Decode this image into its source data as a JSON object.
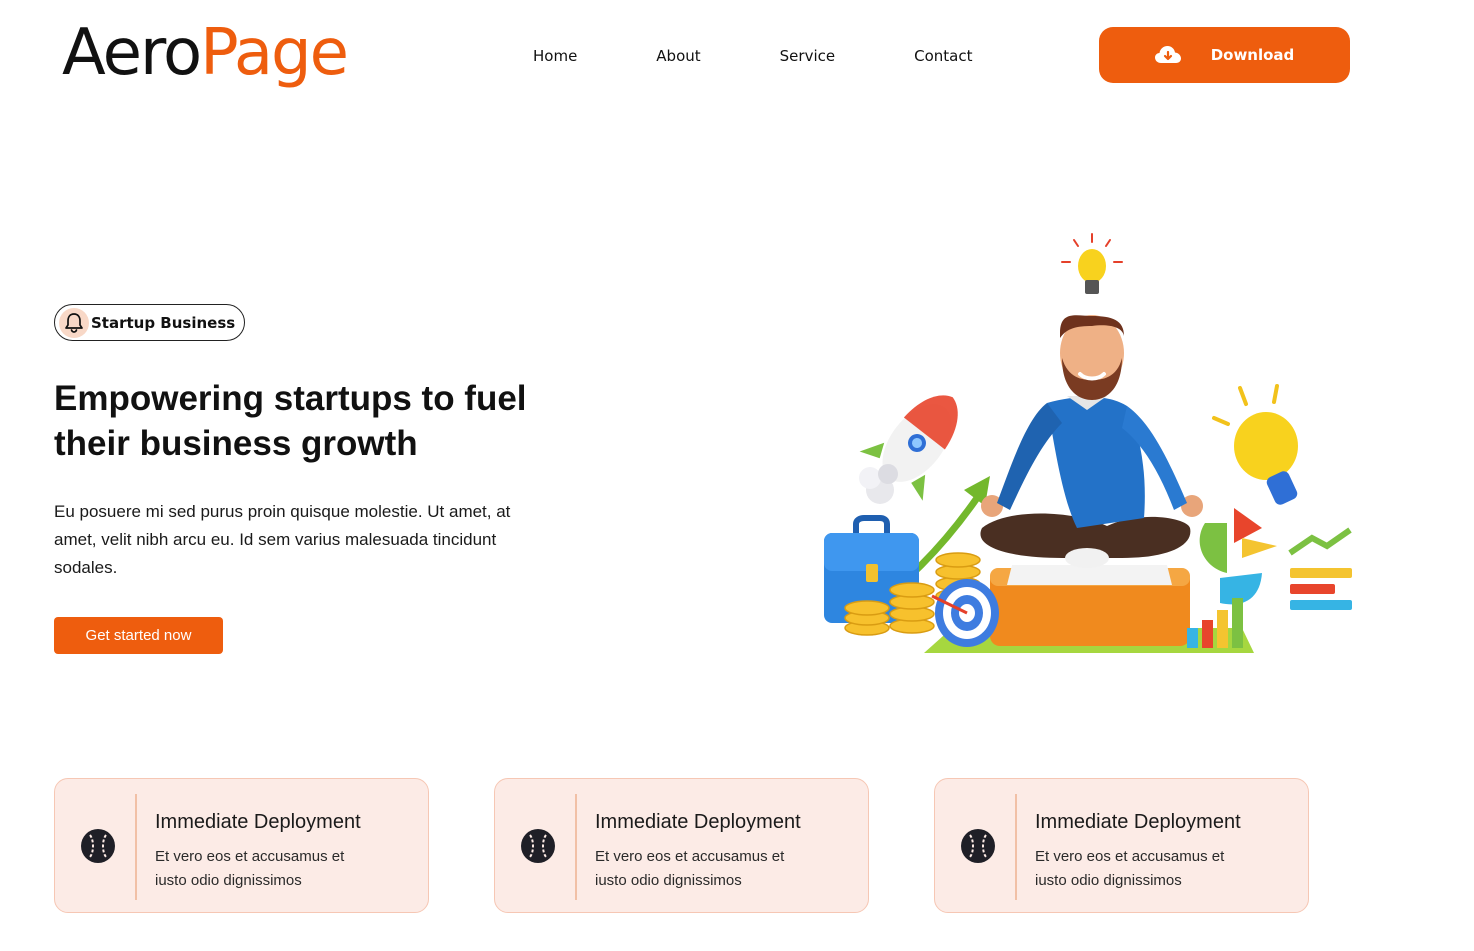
{
  "header": {
    "logo_part1": "Aero",
    "logo_part2": "Page",
    "nav": [
      "Home",
      "About",
      "Service",
      "Contact"
    ],
    "download_label": "Download",
    "download_icon": "cloud-download-icon"
  },
  "hero": {
    "badge_icon": "bell-icon",
    "badge_label": "Startup Business",
    "title_line1": "Empowering startups to fuel",
    "title_line2": "their business growth",
    "description": "Eu posuere mi sed purus proin quisque molestie. Ut amet, at amet, velit nibh arcu eu. Id sem varius malesuada tincidunt sodales.",
    "cta_label": "Get started now",
    "illustration": "meditating-businessman-illustration"
  },
  "features": [
    {
      "icon": "baseball-icon",
      "title": "Immediate Deployment",
      "text_line1": "Et vero eos et accusamus et",
      "text_line2": "iusto odio dignissimos"
    },
    {
      "icon": "baseball-icon",
      "title": "Immediate Deployment",
      "text_line1": "Et vero eos et accusamus et",
      "text_line2": "iusto odio dignissimos"
    },
    {
      "icon": "baseball-icon",
      "title": "Immediate Deployment",
      "text_line1": "Et vero eos et accusamus et",
      "text_line2": "iusto odio dignissimos"
    }
  ],
  "colors": {
    "accent": "#ee5d0e",
    "card_bg": "#fcebe6",
    "card_border": "#f6c7b4",
    "text": "#111111"
  }
}
